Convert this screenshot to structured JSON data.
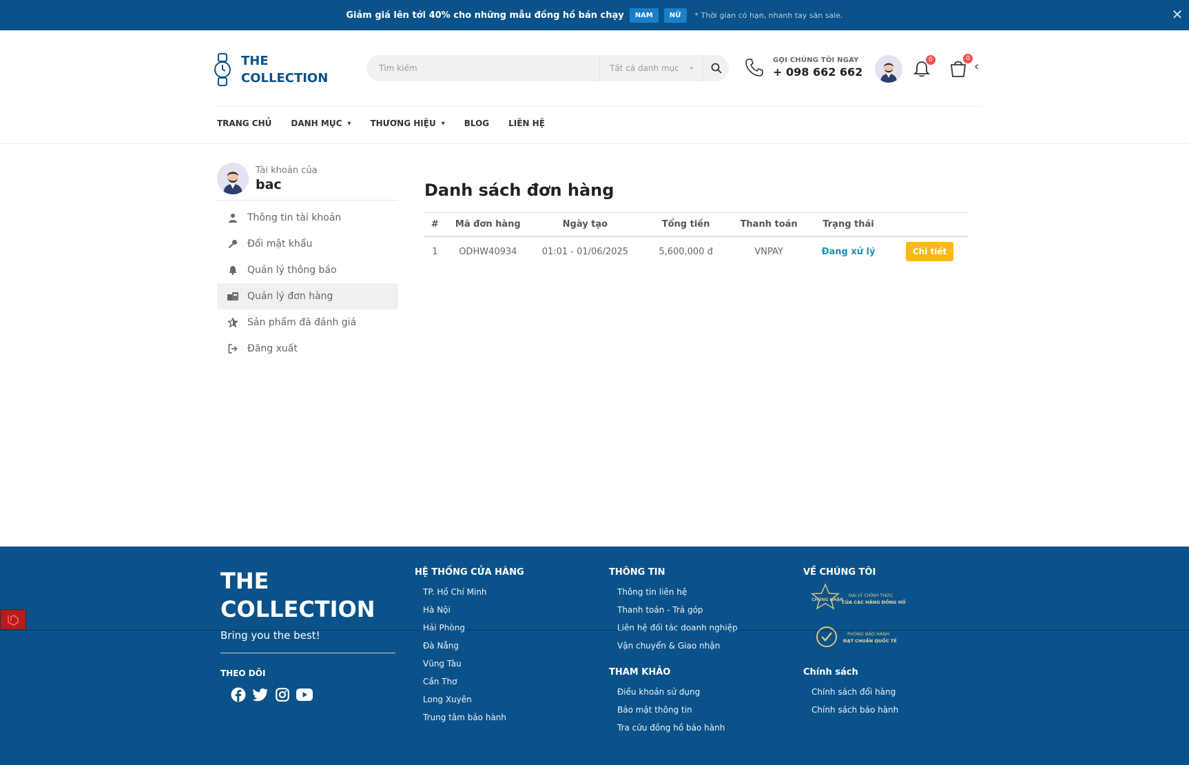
{
  "promo": {
    "text_before": "Giảm giá lên tới ",
    "text_bold": "40%",
    "text_after": " cho những mẫu đồng hồ bán chạy",
    "tag_men": "NAM",
    "tag_women": "NỮ",
    "note": "* Thời gian có hạn, nhanh tay săn sale.",
    "close_icon": "close-icon"
  },
  "header": {
    "logo_line1": "THE",
    "logo_line2": "COLLECTION",
    "search_placeholder": "Tìm kiếm",
    "category_select": "Tất cả danh mục",
    "phone_label": "GỌI CHÚNG TÔI NGAY",
    "phone_number": "+ 098 662 662",
    "notifications_count": "0",
    "cart_count": "0"
  },
  "nav": {
    "home": "TRANG CHỦ",
    "categories": "DANH MỤC",
    "brands": "THƯƠNG HIỆU",
    "blog": "BLOG",
    "contact": "LIÊN HỆ"
  },
  "sidebar": {
    "account_of": "Tài khoản của",
    "username": "bac",
    "items": [
      {
        "label": "Thông tin tài khoản",
        "icon": "user-icon"
      },
      {
        "label": "Đổi mật khẩu",
        "icon": "key-icon"
      },
      {
        "label": "Quản lý thông báo",
        "icon": "bell-icon"
      },
      {
        "label": "Quản lý đơn hàng",
        "icon": "orders-icon",
        "active": true
      },
      {
        "label": "Sản phẩm đã đánh giá",
        "icon": "star-icon"
      },
      {
        "label": "Đăng xuất",
        "icon": "logout-icon"
      }
    ]
  },
  "orders": {
    "title": "Danh sách đơn hàng",
    "columns": [
      "#",
      "Mã đơn hàng",
      "Ngày tạo",
      "Tổng tiền",
      "Thanh toán",
      "Trạng thái",
      ""
    ],
    "rows": [
      {
        "index": "1",
        "code": "ODHW40934",
        "created": "01:01 - 01/06/2025",
        "total": "5,600,000 đ",
        "payment": "VNPAY",
        "status": "Đang xử lý",
        "action": "Chi tiết"
      }
    ],
    "status_color": "#1e8fb8",
    "action_color": "#f9b911"
  },
  "footer": {
    "brand_line1": "THE",
    "brand_line2": "COLLECTION",
    "tagline": "Bring you the best!",
    "follow": "THEO DÕI",
    "stores_title": "HỆ THỐNG CỬA HÀNG",
    "stores": [
      "TP. Hồ Chí Minh",
      "Hà Nội",
      "Hải Phòng",
      "Đà Nẵng",
      "Vũng Tàu",
      "Cần Thơ",
      "Long Xuyên",
      "Trung tâm bảo hành"
    ],
    "info_title": "THÔNG TIN",
    "info": [
      "Thông tin liên hệ",
      "Thanh toán - Trả góp",
      "Liên hệ đối tác doanh nghiệp",
      "Vận chuyển & Giao nhận"
    ],
    "ref_title": "THAM KHẢO",
    "ref": [
      "Điều khoản sử dụng",
      "Bảo mật thông tin",
      "Tra cứu đồng hồ bảo hành"
    ],
    "about_title": "VỀ CHÚNG TÔI",
    "cert1_line1": "ĐẠI LÝ CHÍNH THỨC",
    "cert1_line2": "CỦA CÁC HÃNG ĐỒNG HỒ",
    "cert1_star": "CHỨNG NHẬN",
    "cert2_line1": "PHÒNG BẢO HÀNH",
    "cert2_line2": "ĐẠT CHUẨN QUỐC TẾ",
    "policy_title": "Chính sách",
    "policy": [
      "Chính sách đổi hàng",
      "Chính sách bảo hành"
    ],
    "brand_color": "#0a5289"
  }
}
